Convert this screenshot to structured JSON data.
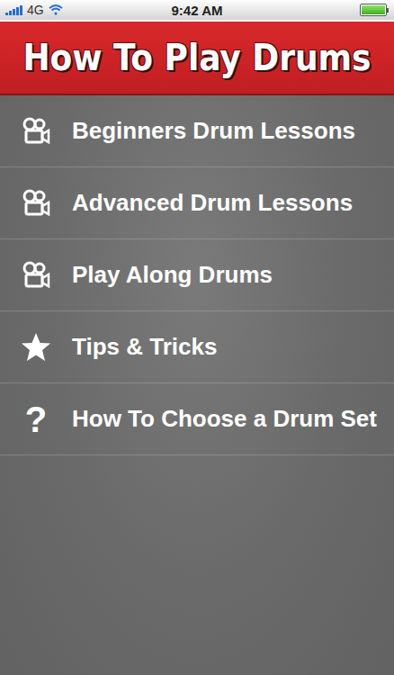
{
  "status_bar": {
    "network": "4G",
    "time": "9:42 AM",
    "signal": 5,
    "battery": 1.0
  },
  "header": {
    "title": "How To Play Drums"
  },
  "menu": {
    "items": [
      {
        "label": "Beginners Drum Lessons",
        "kind": "video"
      },
      {
        "label": "Advanced Drum Lessons",
        "kind": "video"
      },
      {
        "label": "Play Along Drums",
        "kind": "video"
      },
      {
        "label": "Tips & Tricks",
        "kind": "star"
      },
      {
        "label": "How To Choose a Drum Set",
        "kind": "glyph",
        "glyph": "?"
      }
    ]
  }
}
